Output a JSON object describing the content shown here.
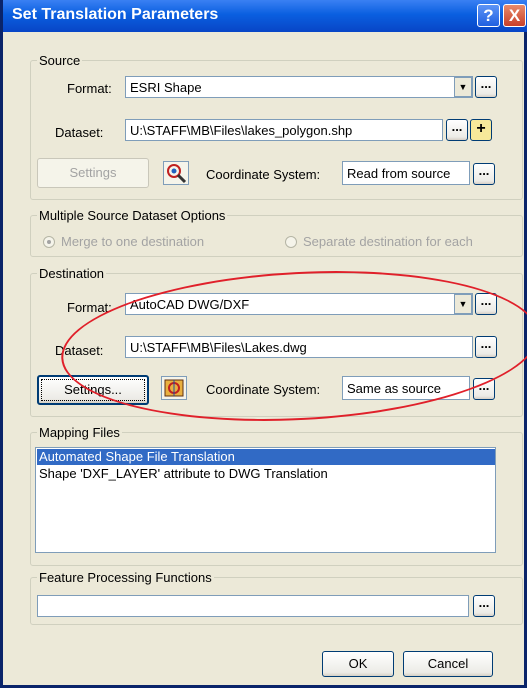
{
  "window": {
    "title": "Set Translation Parameters",
    "help_glyph": "?",
    "close_glyph": "X"
  },
  "source": {
    "group_label": "Source",
    "format_label": "Format:",
    "format_value": "ESRI Shape",
    "dataset_label": "Dataset:",
    "dataset_value": "U:\\STAFF\\MB\\Files\\lakes_polygon.shp",
    "settings_label": "Settings",
    "coord_label": "Coordinate System:",
    "coord_value": "Read from source"
  },
  "multi_source": {
    "group_label": "Multiple Source Dataset Options",
    "merge_label": "Merge to one destination",
    "separate_label": "Separate destination for each"
  },
  "destination": {
    "group_label": "Destination",
    "format_label": "Format:",
    "format_value": "AutoCAD DWG/DXF",
    "dataset_label": "Dataset:",
    "dataset_value": "U:\\STAFF\\MB\\Files\\Lakes.dwg",
    "settings_label": "Settings...",
    "coord_label": "Coordinate System:",
    "coord_value": "Same as source"
  },
  "mapping": {
    "group_label": "Mapping Files",
    "items": [
      "Automated Shape File Translation",
      "Shape 'DXF_LAYER' attribute to DWG Translation"
    ]
  },
  "feature": {
    "group_label": "Feature Processing Functions",
    "value": ""
  },
  "buttons": {
    "ok": "OK",
    "cancel": "Cancel",
    "ellipsis": "...",
    "plus": "+"
  },
  "colors": {
    "titlebar": "#0A5FE0",
    "selection": "#316AC5",
    "annotation": "#E0202A"
  }
}
